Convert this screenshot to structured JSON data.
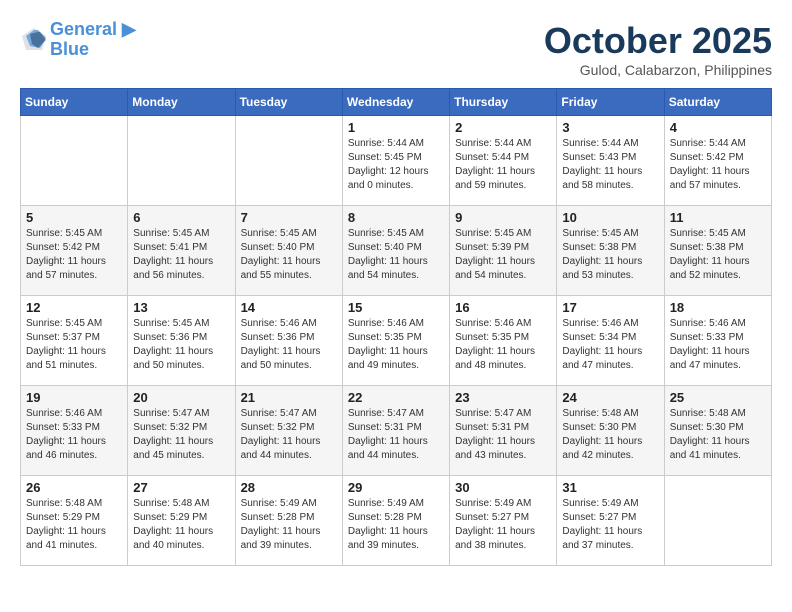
{
  "header": {
    "logo_line1": "General",
    "logo_line2": "Blue",
    "month_title": "October 2025",
    "location": "Gulod, Calabarzon, Philippines"
  },
  "days_of_week": [
    "Sunday",
    "Monday",
    "Tuesday",
    "Wednesday",
    "Thursday",
    "Friday",
    "Saturday"
  ],
  "weeks": [
    [
      {
        "day": "",
        "info": ""
      },
      {
        "day": "",
        "info": ""
      },
      {
        "day": "",
        "info": ""
      },
      {
        "day": "1",
        "info": "Sunrise: 5:44 AM\nSunset: 5:45 PM\nDaylight: 12 hours\nand 0 minutes."
      },
      {
        "day": "2",
        "info": "Sunrise: 5:44 AM\nSunset: 5:44 PM\nDaylight: 11 hours\nand 59 minutes."
      },
      {
        "day": "3",
        "info": "Sunrise: 5:44 AM\nSunset: 5:43 PM\nDaylight: 11 hours\nand 58 minutes."
      },
      {
        "day": "4",
        "info": "Sunrise: 5:44 AM\nSunset: 5:42 PM\nDaylight: 11 hours\nand 57 minutes."
      }
    ],
    [
      {
        "day": "5",
        "info": "Sunrise: 5:45 AM\nSunset: 5:42 PM\nDaylight: 11 hours\nand 57 minutes."
      },
      {
        "day": "6",
        "info": "Sunrise: 5:45 AM\nSunset: 5:41 PM\nDaylight: 11 hours\nand 56 minutes."
      },
      {
        "day": "7",
        "info": "Sunrise: 5:45 AM\nSunset: 5:40 PM\nDaylight: 11 hours\nand 55 minutes."
      },
      {
        "day": "8",
        "info": "Sunrise: 5:45 AM\nSunset: 5:40 PM\nDaylight: 11 hours\nand 54 minutes."
      },
      {
        "day": "9",
        "info": "Sunrise: 5:45 AM\nSunset: 5:39 PM\nDaylight: 11 hours\nand 54 minutes."
      },
      {
        "day": "10",
        "info": "Sunrise: 5:45 AM\nSunset: 5:38 PM\nDaylight: 11 hours\nand 53 minutes."
      },
      {
        "day": "11",
        "info": "Sunrise: 5:45 AM\nSunset: 5:38 PM\nDaylight: 11 hours\nand 52 minutes."
      }
    ],
    [
      {
        "day": "12",
        "info": "Sunrise: 5:45 AM\nSunset: 5:37 PM\nDaylight: 11 hours\nand 51 minutes."
      },
      {
        "day": "13",
        "info": "Sunrise: 5:45 AM\nSunset: 5:36 PM\nDaylight: 11 hours\nand 50 minutes."
      },
      {
        "day": "14",
        "info": "Sunrise: 5:46 AM\nSunset: 5:36 PM\nDaylight: 11 hours\nand 50 minutes."
      },
      {
        "day": "15",
        "info": "Sunrise: 5:46 AM\nSunset: 5:35 PM\nDaylight: 11 hours\nand 49 minutes."
      },
      {
        "day": "16",
        "info": "Sunrise: 5:46 AM\nSunset: 5:35 PM\nDaylight: 11 hours\nand 48 minutes."
      },
      {
        "day": "17",
        "info": "Sunrise: 5:46 AM\nSunset: 5:34 PM\nDaylight: 11 hours\nand 47 minutes."
      },
      {
        "day": "18",
        "info": "Sunrise: 5:46 AM\nSunset: 5:33 PM\nDaylight: 11 hours\nand 47 minutes."
      }
    ],
    [
      {
        "day": "19",
        "info": "Sunrise: 5:46 AM\nSunset: 5:33 PM\nDaylight: 11 hours\nand 46 minutes."
      },
      {
        "day": "20",
        "info": "Sunrise: 5:47 AM\nSunset: 5:32 PM\nDaylight: 11 hours\nand 45 minutes."
      },
      {
        "day": "21",
        "info": "Sunrise: 5:47 AM\nSunset: 5:32 PM\nDaylight: 11 hours\nand 44 minutes."
      },
      {
        "day": "22",
        "info": "Sunrise: 5:47 AM\nSunset: 5:31 PM\nDaylight: 11 hours\nand 44 minutes."
      },
      {
        "day": "23",
        "info": "Sunrise: 5:47 AM\nSunset: 5:31 PM\nDaylight: 11 hours\nand 43 minutes."
      },
      {
        "day": "24",
        "info": "Sunrise: 5:48 AM\nSunset: 5:30 PM\nDaylight: 11 hours\nand 42 minutes."
      },
      {
        "day": "25",
        "info": "Sunrise: 5:48 AM\nSunset: 5:30 PM\nDaylight: 11 hours\nand 41 minutes."
      }
    ],
    [
      {
        "day": "26",
        "info": "Sunrise: 5:48 AM\nSunset: 5:29 PM\nDaylight: 11 hours\nand 41 minutes."
      },
      {
        "day": "27",
        "info": "Sunrise: 5:48 AM\nSunset: 5:29 PM\nDaylight: 11 hours\nand 40 minutes."
      },
      {
        "day": "28",
        "info": "Sunrise: 5:49 AM\nSunset: 5:28 PM\nDaylight: 11 hours\nand 39 minutes."
      },
      {
        "day": "29",
        "info": "Sunrise: 5:49 AM\nSunset: 5:28 PM\nDaylight: 11 hours\nand 39 minutes."
      },
      {
        "day": "30",
        "info": "Sunrise: 5:49 AM\nSunset: 5:27 PM\nDaylight: 11 hours\nand 38 minutes."
      },
      {
        "day": "31",
        "info": "Sunrise: 5:49 AM\nSunset: 5:27 PM\nDaylight: 11 hours\nand 37 minutes."
      },
      {
        "day": "",
        "info": ""
      }
    ]
  ]
}
